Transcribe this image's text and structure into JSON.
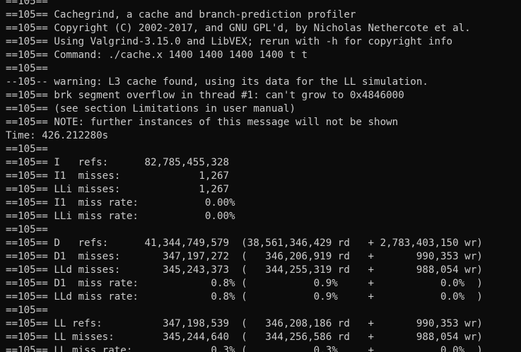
{
  "terminal": {
    "lines": [
      "==105== ",
      "==105== Cachegrind, a cache and branch-prediction profiler",
      "==105== Copyright (C) 2002-2017, and GNU GPL'd, by Nicholas Nethercote et al.",
      "==105== Using Valgrind-3.15.0 and LibVEX; rerun with -h for copyright info",
      "==105== Command: ./cache.x 1400 1400 1400 1400 t t",
      "==105==",
      "--105-- warning: L3 cache found, using its data for the LL simulation.",
      "==105== brk segment overflow in thread #1: can't grow to 0x4846000",
      "==105== (see section Limitations in user manual)",
      "==105== NOTE: further instances of this message will not be shown",
      "Time: 426.212280s",
      "==105==",
      "==105== I   refs:      82,785,455,328",
      "==105== I1  misses:             1,267",
      "==105== LLi misses:             1,267",
      "==105== I1  miss rate:           0.00%",
      "==105== LLi miss rate:           0.00%",
      "==105==",
      "==105== D   refs:      41,344,749,579  (38,561,346,429 rd   + 2,783,403,150 wr)",
      "==105== D1  misses:       347,197,272  (   346,206,919 rd   +       990,353 wr)",
      "==105== LLd misses:       345,243,373  (   344,255,319 rd   +       988,054 wr)",
      "==105== D1  miss rate:            0.8% (           0.9%     +           0.0%  )",
      "==105== LLd miss rate:            0.8% (           0.9%     +           0.0%  )",
      "==105==",
      "==105== LL refs:          347,198,539  (   346,208,186 rd   +       990,353 wr)",
      "==105== LL misses:        345,244,640  (   344,256,586 rd   +       988,054 wr)",
      "==105== LL miss rate:             0.3% (           0.3%     +           0.0%  )"
    ]
  }
}
